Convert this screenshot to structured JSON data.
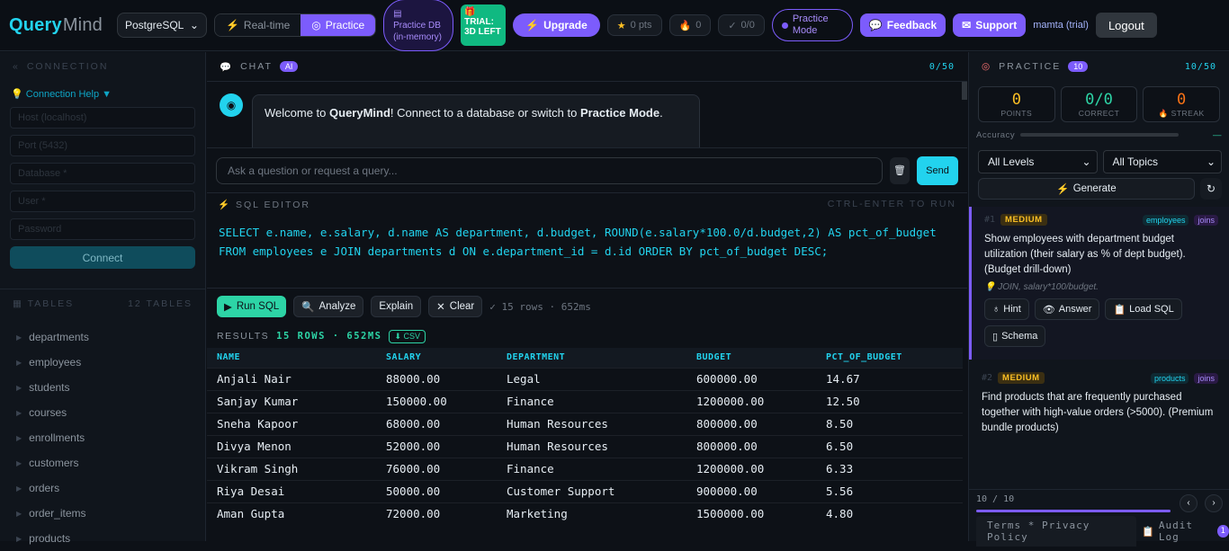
{
  "header": {
    "logo_query": "Query",
    "logo_mind": "Mind",
    "db_select": "PostgreSQL",
    "mode_realtime": "Real-time",
    "mode_practice": "Practice",
    "practice_db": "Practice DB (in-memory)",
    "trial": "TRIAL: 3D LEFT",
    "upgrade": "Upgrade",
    "points": "0 pts",
    "streak": "0",
    "ratio": "0/0",
    "practice_mode": "Practice Mode",
    "feedback": "Feedback",
    "support": "Support",
    "user": "mamta (trial)",
    "logout": "Logout"
  },
  "sidebar": {
    "connection_title": "CONNECTION",
    "connection_help": "Connection Help ▼",
    "host_ph": "Host (localhost)",
    "port_ph": "Port (5432)",
    "database_ph": "Database *",
    "user_ph": "User *",
    "password_ph": "Password",
    "connect": "Connect",
    "tables_title": "TABLES",
    "tables_count": "12 TABLES",
    "tables": [
      "departments",
      "employees",
      "students",
      "courses",
      "enrollments",
      "customers",
      "orders",
      "order_items",
      "products"
    ]
  },
  "chat": {
    "title": "CHAT",
    "badge": "AI",
    "counter": "0/50",
    "welcome_a": "Welcome to ",
    "welcome_b": "QueryMind",
    "welcome_c": "! Connect to a database or switch to ",
    "welcome_d": "Practice Mode",
    "welcome_e": ".",
    "placeholder": "Ask a question or request a query...",
    "send": "Send"
  },
  "editor": {
    "title": "SQL EDITOR",
    "shortcut": "CTRL-ENTER TO RUN",
    "line1": "SELECT e.name, e.salary, d.name AS department, d.budget, ROUND(e.salary*100.0/d.budget,2) AS pct_of_budget",
    "line2": "FROM employees e JOIN departments d ON e.department_id = d.id ORDER BY pct_of_budget DESC;",
    "run": "Run SQL",
    "analyze": "Analyze",
    "explain": "Explain",
    "clear": "Clear",
    "meta": "15 rows · 652ms"
  },
  "results": {
    "label": "RESULTS",
    "summary": "15 ROWS · 652MS",
    "csv": "CSV",
    "columns": [
      "NAME",
      "SALARY",
      "DEPARTMENT",
      "BUDGET",
      "PCT_OF_BUDGET"
    ],
    "rows": [
      [
        "Anjali Nair",
        "88000.00",
        "Legal",
        "600000.00",
        "14.67"
      ],
      [
        "Sanjay Kumar",
        "150000.00",
        "Finance",
        "1200000.00",
        "12.50"
      ],
      [
        "Sneha Kapoor",
        "68000.00",
        "Human Resources",
        "800000.00",
        "8.50"
      ],
      [
        "Divya Menon",
        "52000.00",
        "Human Resources",
        "800000.00",
        "6.50"
      ],
      [
        "Vikram Singh",
        "76000.00",
        "Finance",
        "1200000.00",
        "6.33"
      ],
      [
        "Riya Desai",
        "50000.00",
        "Customer Support",
        "900000.00",
        "5.56"
      ],
      [
        "Aman Gupta",
        "72000.00",
        "Marketing",
        "1500000.00",
        "4.80"
      ]
    ]
  },
  "practice": {
    "title": "PRACTICE",
    "badge": "10",
    "counter": "10/50",
    "points_v": "0",
    "points_l": "POINTS",
    "correct_v": "0/0",
    "correct_l": "CORRECT",
    "streak_v": "0",
    "streak_l": "STREAK",
    "accuracy": "Accuracy",
    "accuracy_val": "—",
    "levels": "All Levels",
    "topics": "All Topics",
    "generate": "Generate",
    "cards": [
      {
        "num": "#1",
        "level": "MEDIUM",
        "tag1": "employees",
        "tag2": "joins",
        "text": "Show employees with department budget utilization (their salary as % of dept budget). (Budget drill-down)",
        "hint": "JOIN, salary*100/budget."
      },
      {
        "num": "#2",
        "level": "MEDIUM",
        "tag1": "products",
        "tag2": "joins",
        "text": "Find products that are frequently purchased together with high-value orders (>5000). (Premium bundle products)"
      }
    ],
    "btn_hint": "Hint",
    "btn_answer": "Answer",
    "btn_load": "Load SQL",
    "btn_schema": "Schema",
    "pager": "10 / 10",
    "terms": "Terms * Privacy Policy",
    "audit": "Audit Log",
    "audit_count": "1"
  },
  "colors": {
    "accent": "#22d3ee",
    "purple": "#7c5cfc",
    "green": "#2dd4a6",
    "amber": "#fbbf24"
  }
}
